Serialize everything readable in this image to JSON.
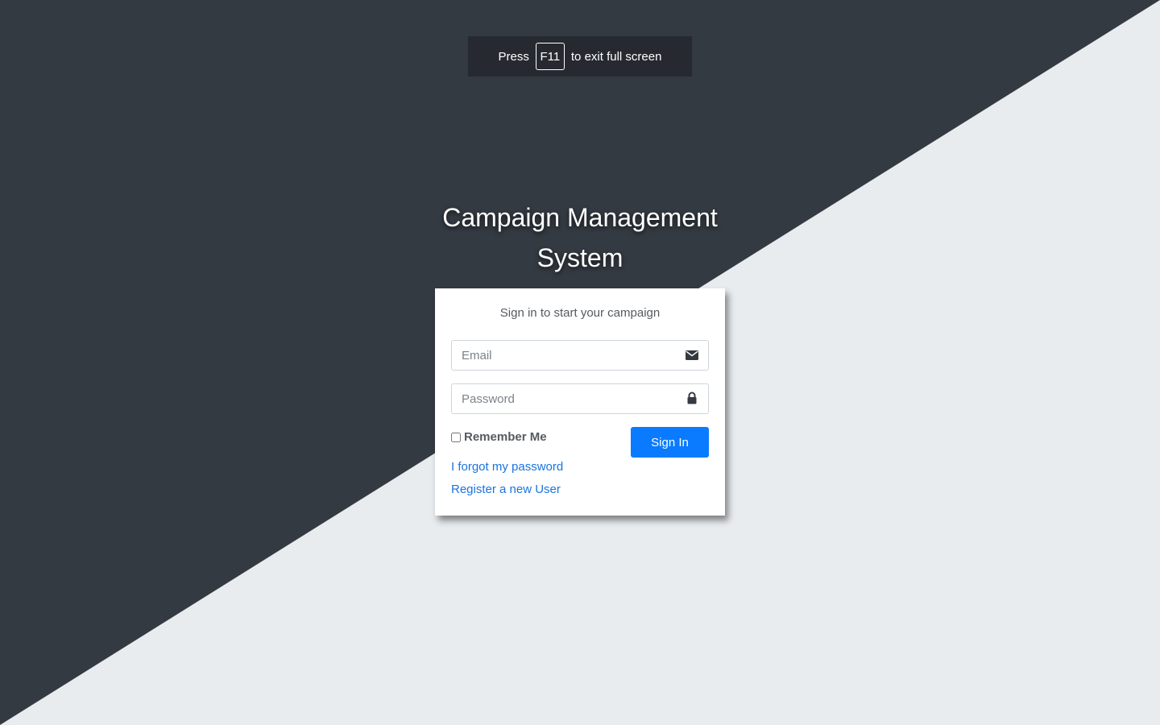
{
  "fullscreen_banner": {
    "prefix": "Press",
    "key": "F11",
    "suffix": "to exit full screen"
  },
  "header": {
    "title": "Campaign Management",
    "subtitle": "System"
  },
  "login": {
    "message": "Sign in to start your campaign",
    "email": {
      "placeholder": "Email",
      "value": "",
      "icon": "envelope-icon"
    },
    "password": {
      "placeholder": "Password",
      "value": "",
      "icon": "lock-icon"
    },
    "remember_label": "Remember Me",
    "remember_checked": false,
    "signin_label": "Sign In",
    "forgot_label": "I forgot my password",
    "register_label": "Register a new User"
  },
  "colors": {
    "dark_bg": "#343a42",
    "light_bg": "#e8ecef",
    "primary": "#0a7bff",
    "link": "#1a74e0"
  }
}
